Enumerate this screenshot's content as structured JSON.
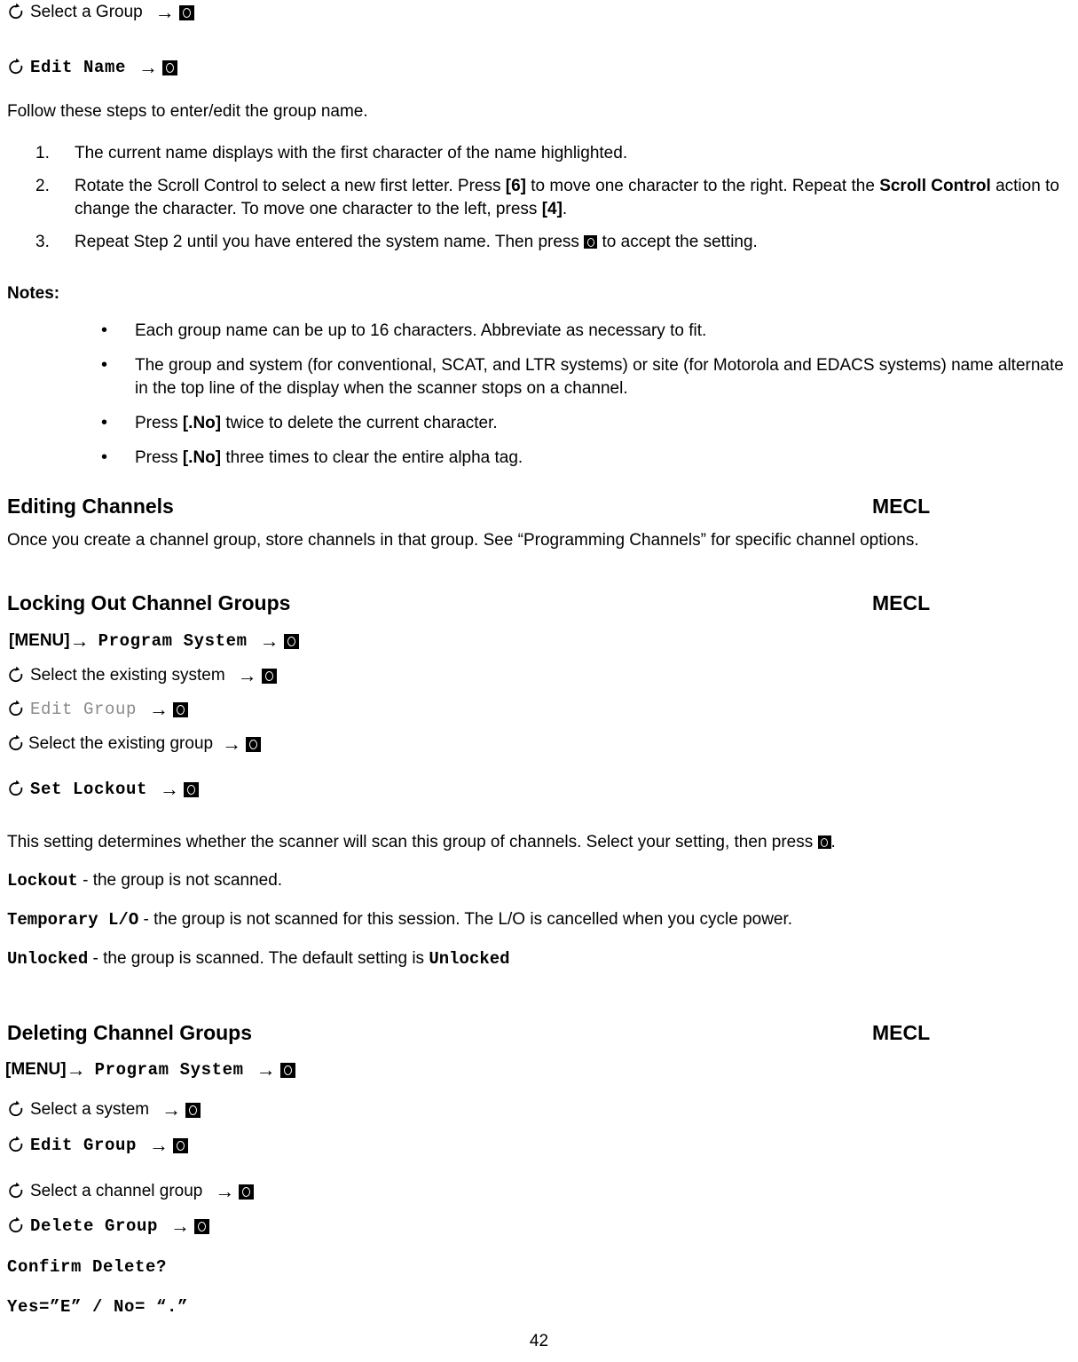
{
  "document": {
    "page_number": "42"
  },
  "icons": {
    "rotate": "rotate-scroll-icon",
    "arrow": "right-arrow-icon",
    "enter_key": "enter-key-icon"
  },
  "nav_top": [
    {
      "label": "Select a Group",
      "style": "sans"
    },
    {
      "label": "Edit Name",
      "style": "mono-bold"
    }
  ],
  "intro": {
    "text": "Follow these steps to enter/edit the group name."
  },
  "steps": [
    {
      "num": "1.",
      "parts": [
        {
          "t": "The current name displays with the first character of the name highlighted.",
          "s": "plain"
        }
      ]
    },
    {
      "num": "2.",
      "parts": [
        {
          "t": "Rotate the Scroll Control to select a new first letter. Press  ",
          "s": "plain"
        },
        {
          "t": "[6]",
          "s": "bold"
        },
        {
          "t": " to move one character to the right. Repeat the ",
          "s": "plain"
        },
        {
          "t": "Scroll Control",
          "s": "bold"
        },
        {
          "t": " action to change the character. To move one character to the left, press ",
          "s": "plain"
        },
        {
          "t": "[4]",
          "s": "bold"
        },
        {
          "t": ".",
          "s": "plain"
        }
      ]
    },
    {
      "num": "3.",
      "parts": [
        {
          "t": "Repeat Step 2 until you have entered the system name. Then press ",
          "s": "plain"
        },
        {
          "t": "",
          "s": "ekey"
        },
        {
          "t": " to accept the setting.",
          "s": "plain"
        }
      ]
    }
  ],
  "notes": {
    "label": "Notes:",
    "items": [
      [
        {
          "t": "Each group name can be up to 16 characters. Abbreviate as necessary to fit.",
          "s": "plain"
        }
      ],
      [
        {
          "t": "The group and system (for conventional, SCAT, and LTR systems) or site (for Motorola and EDACS systems) name alternate in the top line of the display when the scanner stops on a channel.",
          "s": "plain"
        }
      ],
      [
        {
          "t": "Press ",
          "s": "plain"
        },
        {
          "t": "[.No]",
          "s": "bold"
        },
        {
          "t": " twice to delete the current character.",
          "s": "plain"
        }
      ],
      [
        {
          "t": "Press  ",
          "s": "plain"
        },
        {
          "t": "[.No]",
          "s": "bold"
        },
        {
          "t": " three times to clear the entire alpha tag.",
          "s": "plain"
        }
      ]
    ]
  },
  "sections": [
    {
      "id": "editing-channels",
      "title": "Editing Channels",
      "right_label": "MECL",
      "body": "Once you create a channel group, store channels in that group. See “Programming Channels” for specific channel options."
    },
    {
      "id": "locking-out-channel-groups",
      "title": "Locking Out Channel Groups",
      "right_label": "MECL"
    },
    {
      "id": "deleting-channel-groups",
      "title": "Deleting Channel Groups",
      "right_label": "MECL"
    }
  ],
  "lockout_nav": [
    {
      "prefix_key": "[MENU]",
      "label": "Program System",
      "style": "mono-bold"
    },
    {
      "label": "Select the existing system",
      "style": "sans"
    },
    {
      "label": "Edit Group",
      "style": "mono-gray"
    },
    {
      "label": "Select the existing group",
      "style": "sans"
    },
    {
      "label": "Set Lockout",
      "style": "mono-bold"
    }
  ],
  "lockout_body": {
    "intro_a": "This setting determines whether the scanner will scan this group of channels. Select your setting, then press ",
    "intro_b": ".",
    "options": [
      {
        "term": "Lockout",
        "desc": " - the group is not scanned."
      },
      {
        "term": "Temporary L/O",
        "desc": " - the group is not scanned for this session. The L/O is cancelled when you cycle power."
      },
      {
        "term": "Unlocked",
        "desc_a": " - the group is scanned. The default setting is ",
        "desc_term": "Unlocked"
      }
    ]
  },
  "delete_nav": [
    {
      "prefix_key": "[MENU]",
      "label": "Program System",
      "style": "mono-bold"
    },
    {
      "label": "Select a system",
      "style": "sans"
    },
    {
      "label": "Edit Group",
      "style": "mono-bold"
    },
    {
      "label": "Select a channel group",
      "style": "sans"
    },
    {
      "label": "Delete Group",
      "style": "mono-bold"
    }
  ],
  "delete_prompts": [
    "Confirm Delete?",
    "Yes=”E” / No= “.”"
  ]
}
